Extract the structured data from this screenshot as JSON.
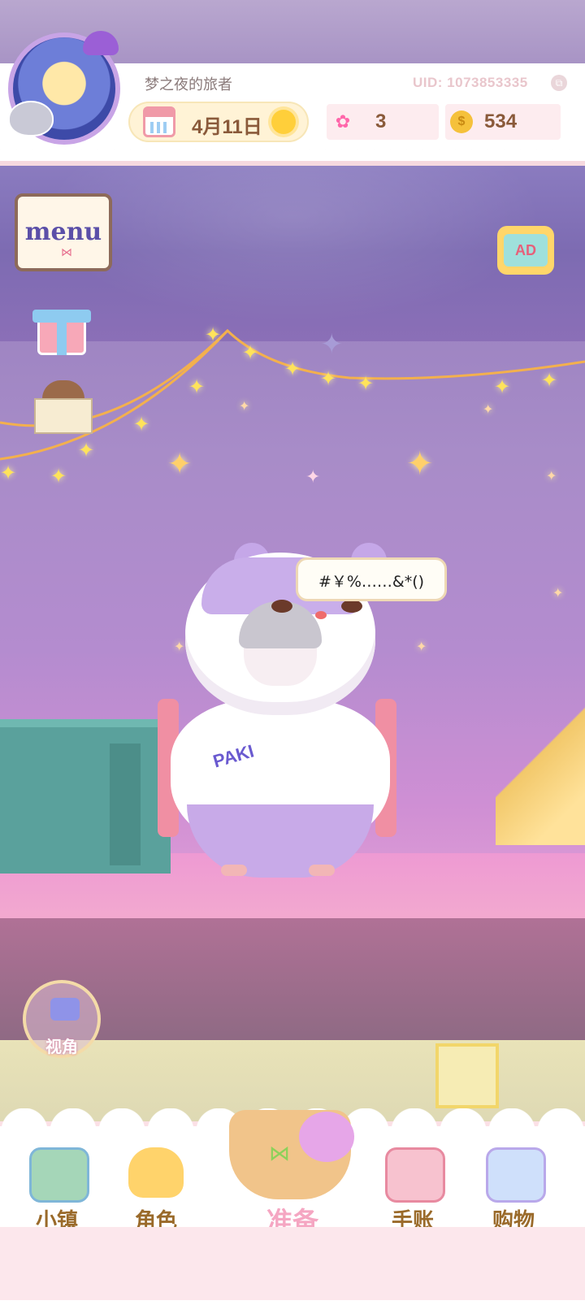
{
  "player": {
    "name": "梦之夜的旅者",
    "uid": "UID: 1073853335"
  },
  "status": {
    "date": "4月11日",
    "weather_icon": "sun-icon",
    "gems": "3",
    "coins": "534"
  },
  "side_buttons": {
    "menu_label": "menu",
    "ad_label": "AD"
  },
  "character": {
    "speech": "#￥%……&*()",
    "shirt_text": "PAKI"
  },
  "camera": {
    "label": "视角"
  },
  "nav": {
    "town": "小镇",
    "role": "角色",
    "prepare": "准备",
    "journal": "手账",
    "shop": "购物"
  }
}
